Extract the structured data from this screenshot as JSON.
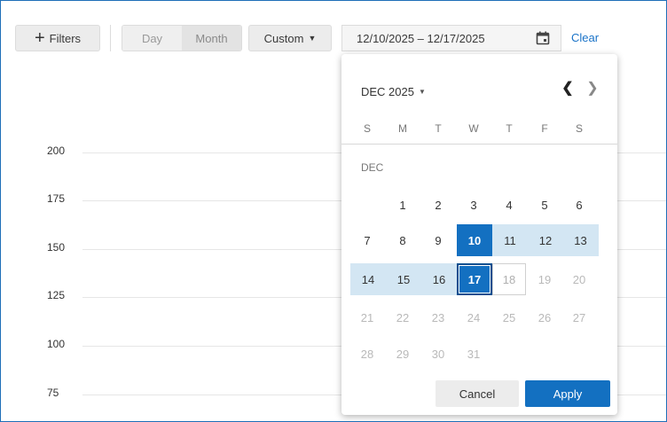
{
  "toolbar": {
    "filters_label": "Filters",
    "day_label": "Day",
    "month_label": "Month",
    "custom_label": "Custom",
    "date_range": "12/10/2025 – 12/17/2025",
    "clear_label": "Clear",
    "icons": {
      "filters": "plus-icon",
      "custom": "caret-down-icon",
      "calendar": "calendar-icon"
    }
  },
  "chart": {
    "y_ticks": [
      "200",
      "175",
      "150",
      "125",
      "100",
      "75"
    ]
  },
  "datepicker": {
    "month_year": "DEC 2025",
    "weekdays": [
      "S",
      "M",
      "T",
      "W",
      "T",
      "F",
      "S"
    ],
    "month_label": "DEC",
    "weeks": [
      [
        {
          "d": ""
        },
        {
          "d": "1"
        },
        {
          "d": "2"
        },
        {
          "d": "3"
        },
        {
          "d": "4"
        },
        {
          "d": "5"
        },
        {
          "d": "6"
        }
      ],
      [
        {
          "d": "7"
        },
        {
          "d": "8"
        },
        {
          "d": "9"
        },
        {
          "d": "10",
          "state": "selstart"
        },
        {
          "d": "11",
          "state": "inrange"
        },
        {
          "d": "12",
          "state": "inrange"
        },
        {
          "d": "13",
          "state": "inrange"
        }
      ],
      [
        {
          "d": "14",
          "state": "inrange"
        },
        {
          "d": "15",
          "state": "inrange"
        },
        {
          "d": "16",
          "state": "inrange"
        },
        {
          "d": "17",
          "state": "selend"
        },
        {
          "d": "18",
          "state": "hover"
        },
        {
          "d": "19",
          "state": "faded"
        },
        {
          "d": "20",
          "state": "faded"
        }
      ],
      [
        {
          "d": "21",
          "state": "faded"
        },
        {
          "d": "22",
          "state": "faded"
        },
        {
          "d": "23",
          "state": "faded"
        },
        {
          "d": "24",
          "state": "faded"
        },
        {
          "d": "25",
          "state": "faded"
        },
        {
          "d": "26",
          "state": "faded"
        },
        {
          "d": "27",
          "state": "faded"
        }
      ],
      [
        {
          "d": "28",
          "state": "faded"
        },
        {
          "d": "29",
          "state": "faded"
        },
        {
          "d": "30",
          "state": "faded"
        },
        {
          "d": "31",
          "state": "faded"
        },
        {
          "d": ""
        },
        {
          "d": ""
        },
        {
          "d": ""
        }
      ]
    ],
    "cancel_label": "Cancel",
    "apply_label": "Apply",
    "icons": {
      "prev": "chevron-left-icon",
      "next": "chevron-right-icon",
      "month_menu": "caret-down-icon"
    }
  },
  "colors": {
    "accent": "#1370c1",
    "range": "#d3e6f3",
    "link": "#1a73c8",
    "frame_border": "#1f6fb8"
  }
}
